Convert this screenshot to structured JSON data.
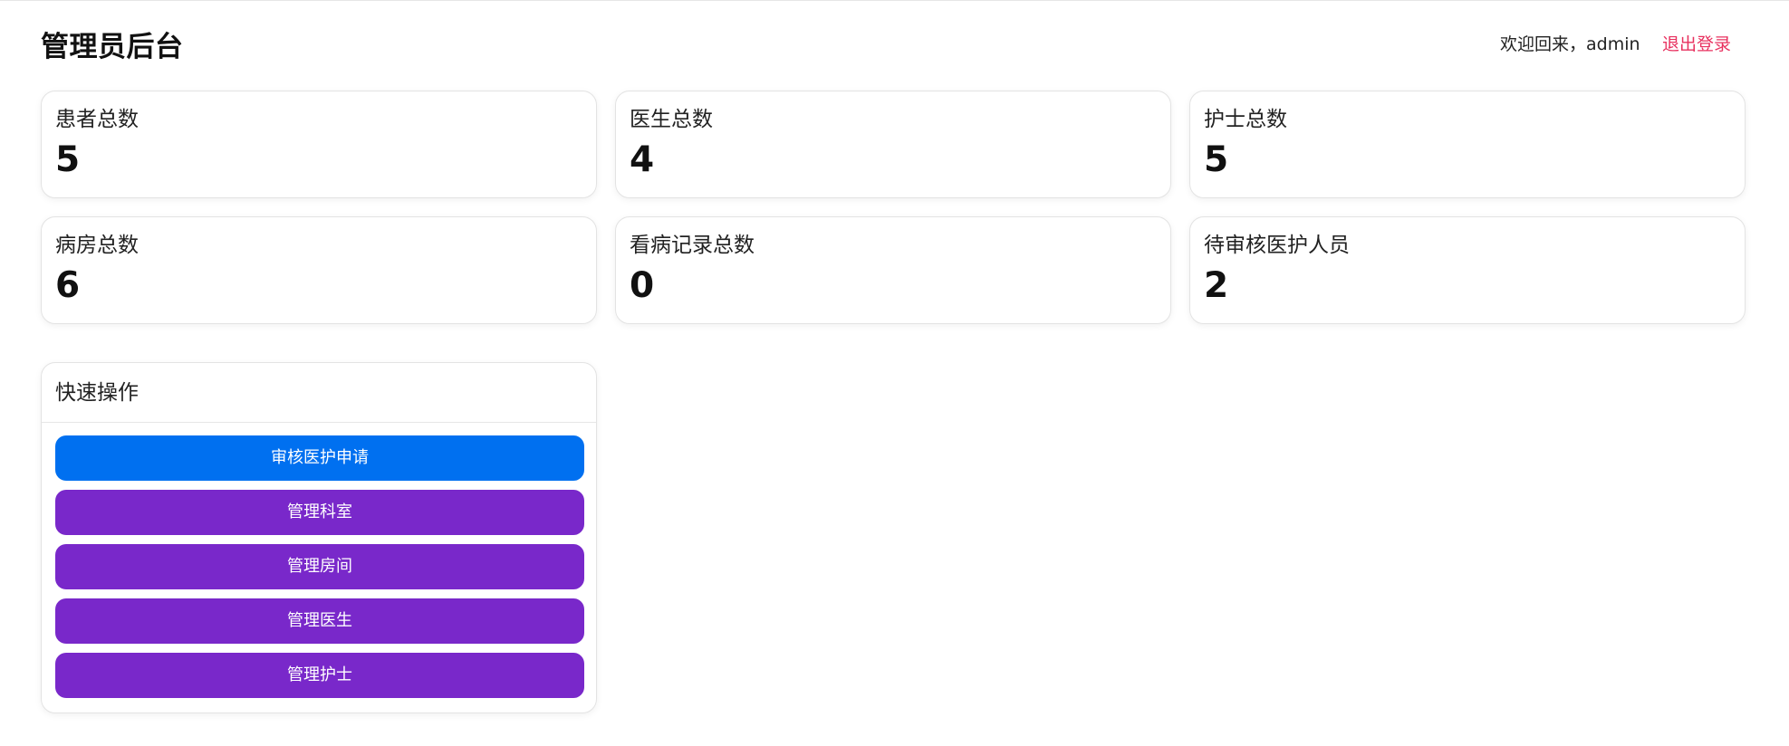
{
  "header": {
    "title": "管理员后台",
    "welcome": "欢迎回来，admin",
    "logout_label": "退出登录"
  },
  "stats": [
    {
      "label": "患者总数",
      "value": "5"
    },
    {
      "label": "医生总数",
      "value": "4"
    },
    {
      "label": "护士总数",
      "value": "5"
    },
    {
      "label": "病房总数",
      "value": "6"
    },
    {
      "label": "看病记录总数",
      "value": "0"
    },
    {
      "label": "待审核医护人员",
      "value": "2"
    }
  ],
  "quick_actions": {
    "title": "快速操作",
    "buttons": [
      {
        "label": "审核医护申请"
      },
      {
        "label": "管理科室"
      },
      {
        "label": "管理房间"
      },
      {
        "label": "管理医生"
      },
      {
        "label": "管理护士"
      }
    ]
  },
  "colors": {
    "primary": "#0070f0",
    "purple": "#7928ca",
    "logout": "#e8315f"
  }
}
